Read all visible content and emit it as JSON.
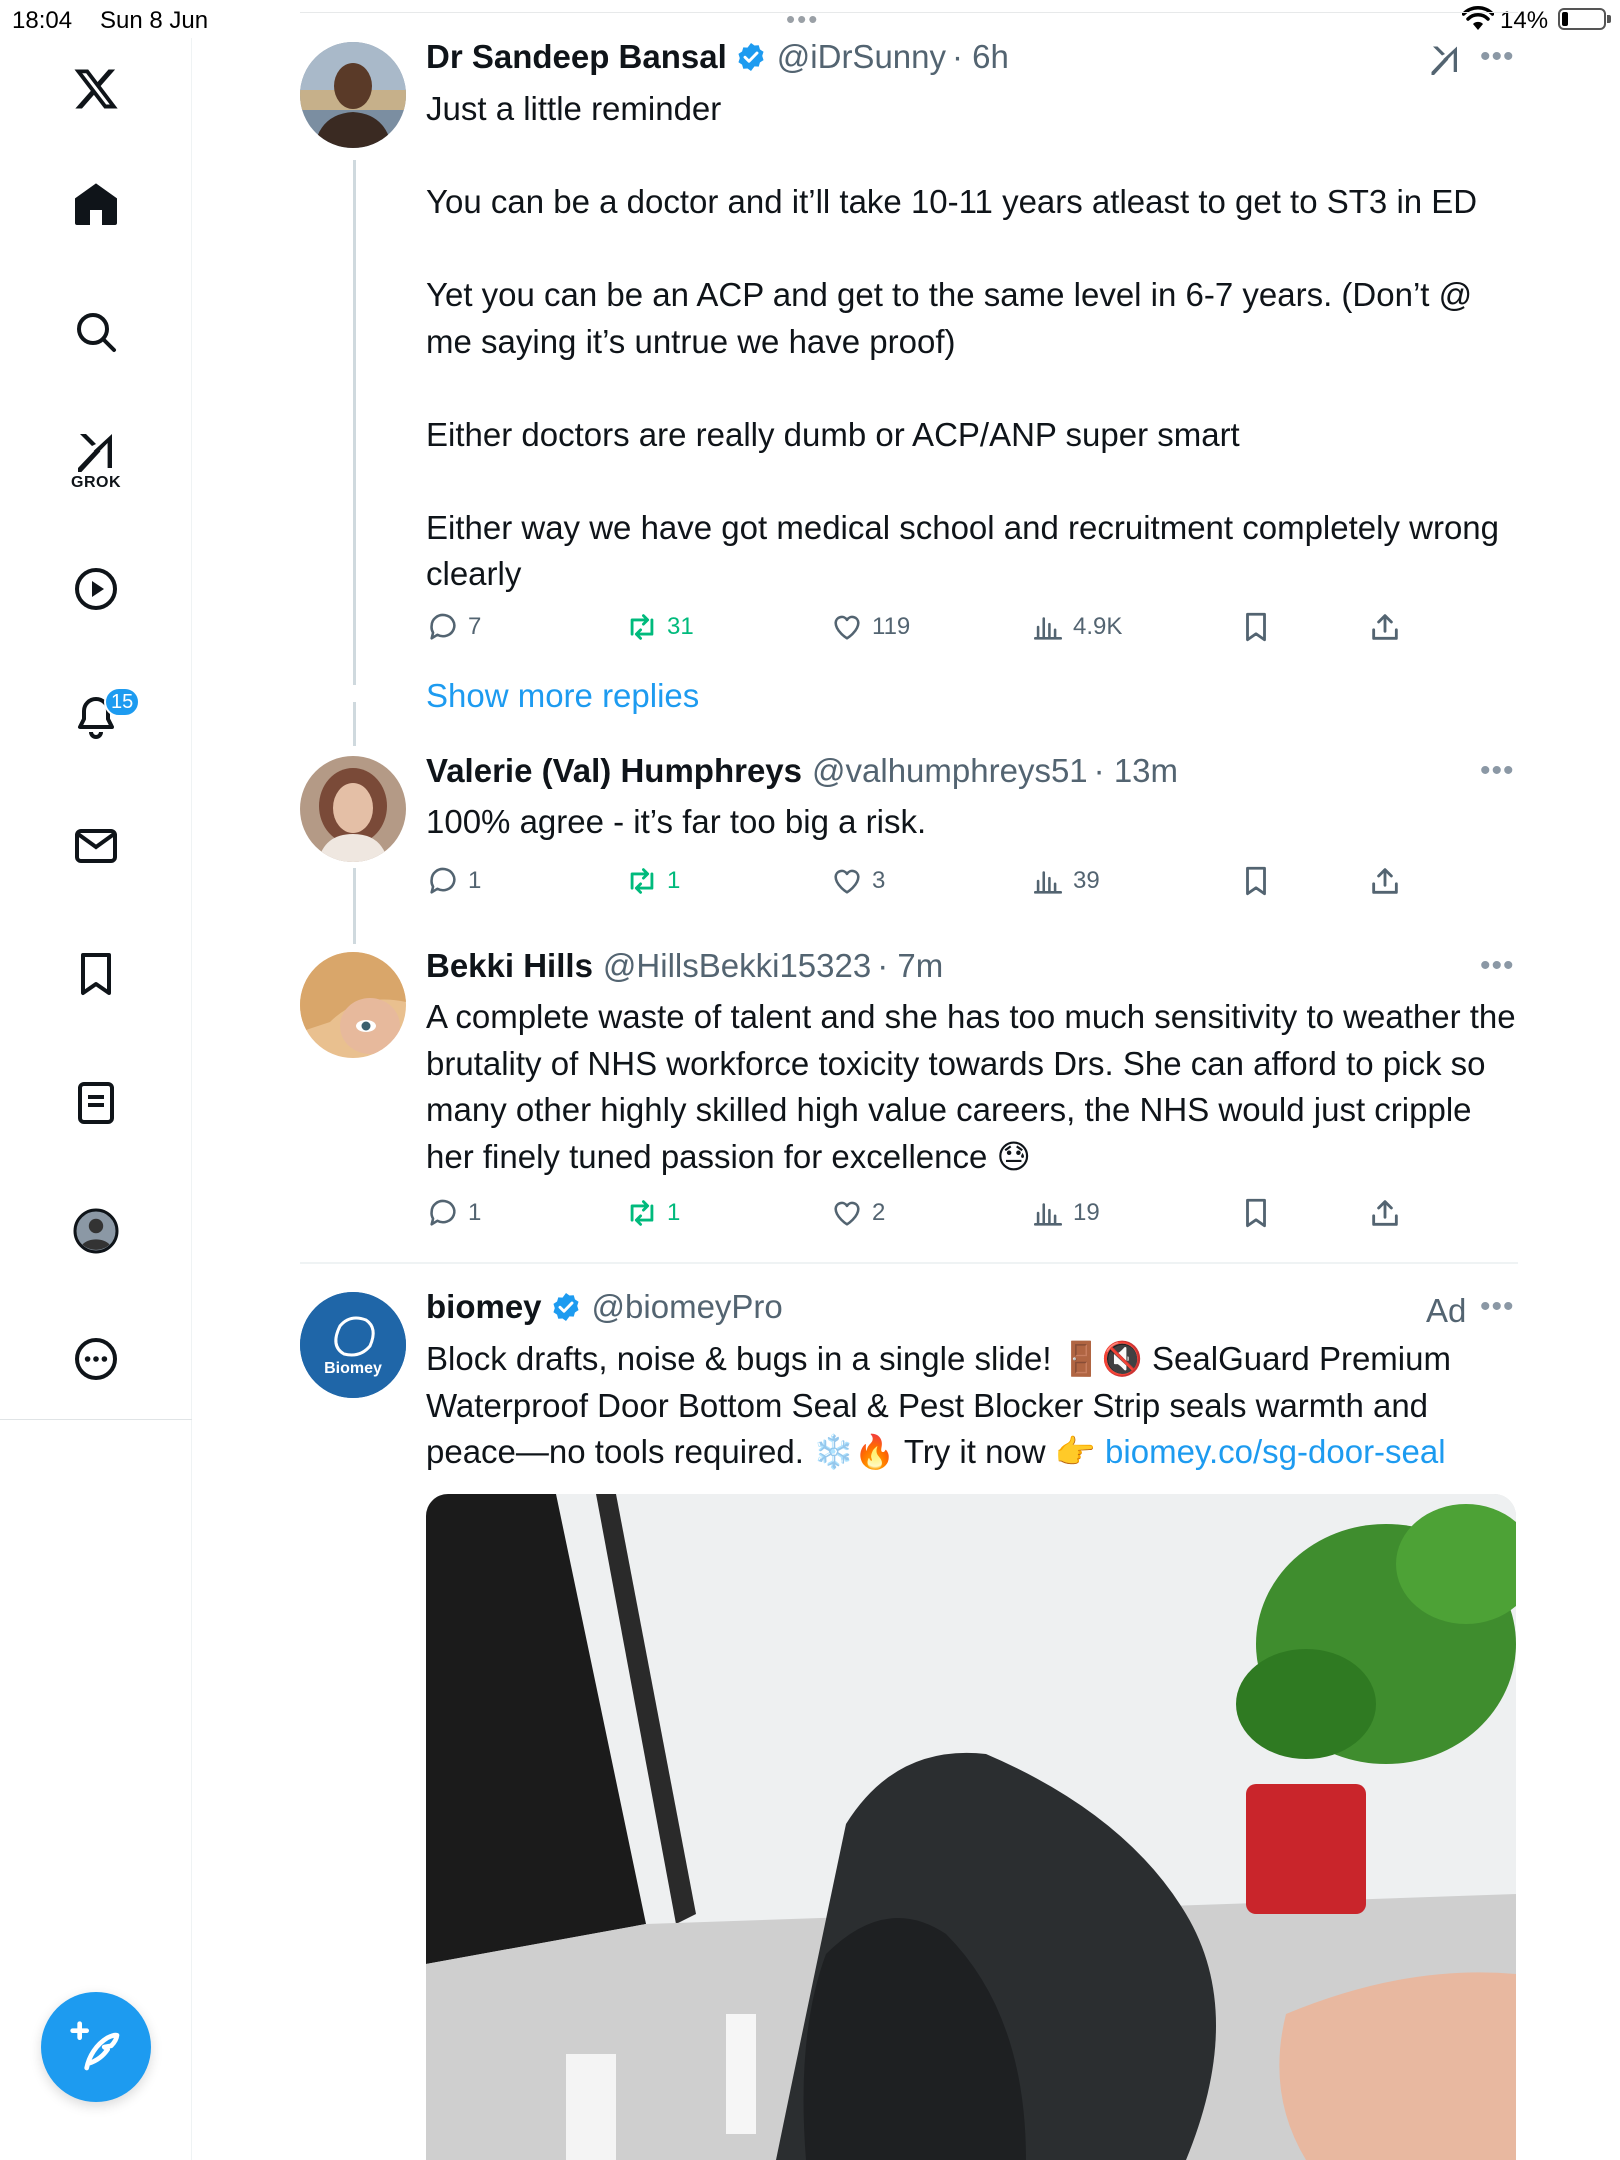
{
  "status_bar": {
    "time": "18:04",
    "date": "Sun 8 Jun",
    "battery": "14%"
  },
  "sidebar": {
    "items": [
      {
        "name": "x-logo-icon"
      },
      {
        "name": "home-icon"
      },
      {
        "name": "search-icon"
      },
      {
        "name": "grok-icon",
        "label": "GROK"
      },
      {
        "name": "video-icon"
      },
      {
        "name": "notifications-icon",
        "badge": "15"
      },
      {
        "name": "messages-icon"
      },
      {
        "name": "bookmarks-icon"
      },
      {
        "name": "lists-icon"
      },
      {
        "name": "profile-icon"
      },
      {
        "name": "more-icon"
      }
    ],
    "compose": "compose-icon",
    "accent": "#1d9bf0"
  },
  "tweets": [
    {
      "name": "Dr Sandeep Bansal",
      "verified": true,
      "handle": "@iDrSunny",
      "time": "· 6h",
      "text": "Just a little reminder\n\nYou can be a doctor and it’ll take 10-11 years atleast to get to ST3 in ED\n\nYet you can be an ACP and get to the same level in 6-7 years. (Don’t @ me saying it’s untrue we have proof)\n\nEither doctors are really dumb or ACP/ANP super smart\n\nEither way we have got medical school and recruitment completely wrong clearly",
      "replies": "7",
      "reposts": "31",
      "likes": "119",
      "views": "4.9K"
    },
    {
      "name": "Valerie (Val) Humphreys",
      "handle": "@valhumphreys51",
      "time": "· 13m",
      "text": "100% agree - it’s far too big a risk.",
      "replies": "1",
      "reposts": "1",
      "likes": "3",
      "views": "39"
    },
    {
      "name": "Bekki Hills",
      "handle": "@HillsBekki15323",
      "time": "· 7m",
      "text": "A complete waste of talent and she has too much sensitivity to weather the brutality of NHS workforce toxicity towards Drs. She can afford to pick so many other highly skilled high value careers, the NHS would just cripple her finely tuned passion for excellence 😓",
      "replies": "1",
      "reposts": "1",
      "likes": "2",
      "views": "19"
    }
  ],
  "show_more_replies": "Show more replies",
  "ad": {
    "name": "biomey",
    "verified": true,
    "handle": "@biomeyPro",
    "label": "Ad",
    "avatar_text": "Biomey",
    "text_before_link": "Block drafts, noise & bugs in a single slide! 🚪🔇 SealGuard Premium Waterproof Door Bottom Seal & Pest Blocker Strip seals warmth and peace—no tools required. ❄️🔥 Try it now 👉 ",
    "link": "biomey.co/sg-door-seal"
  }
}
